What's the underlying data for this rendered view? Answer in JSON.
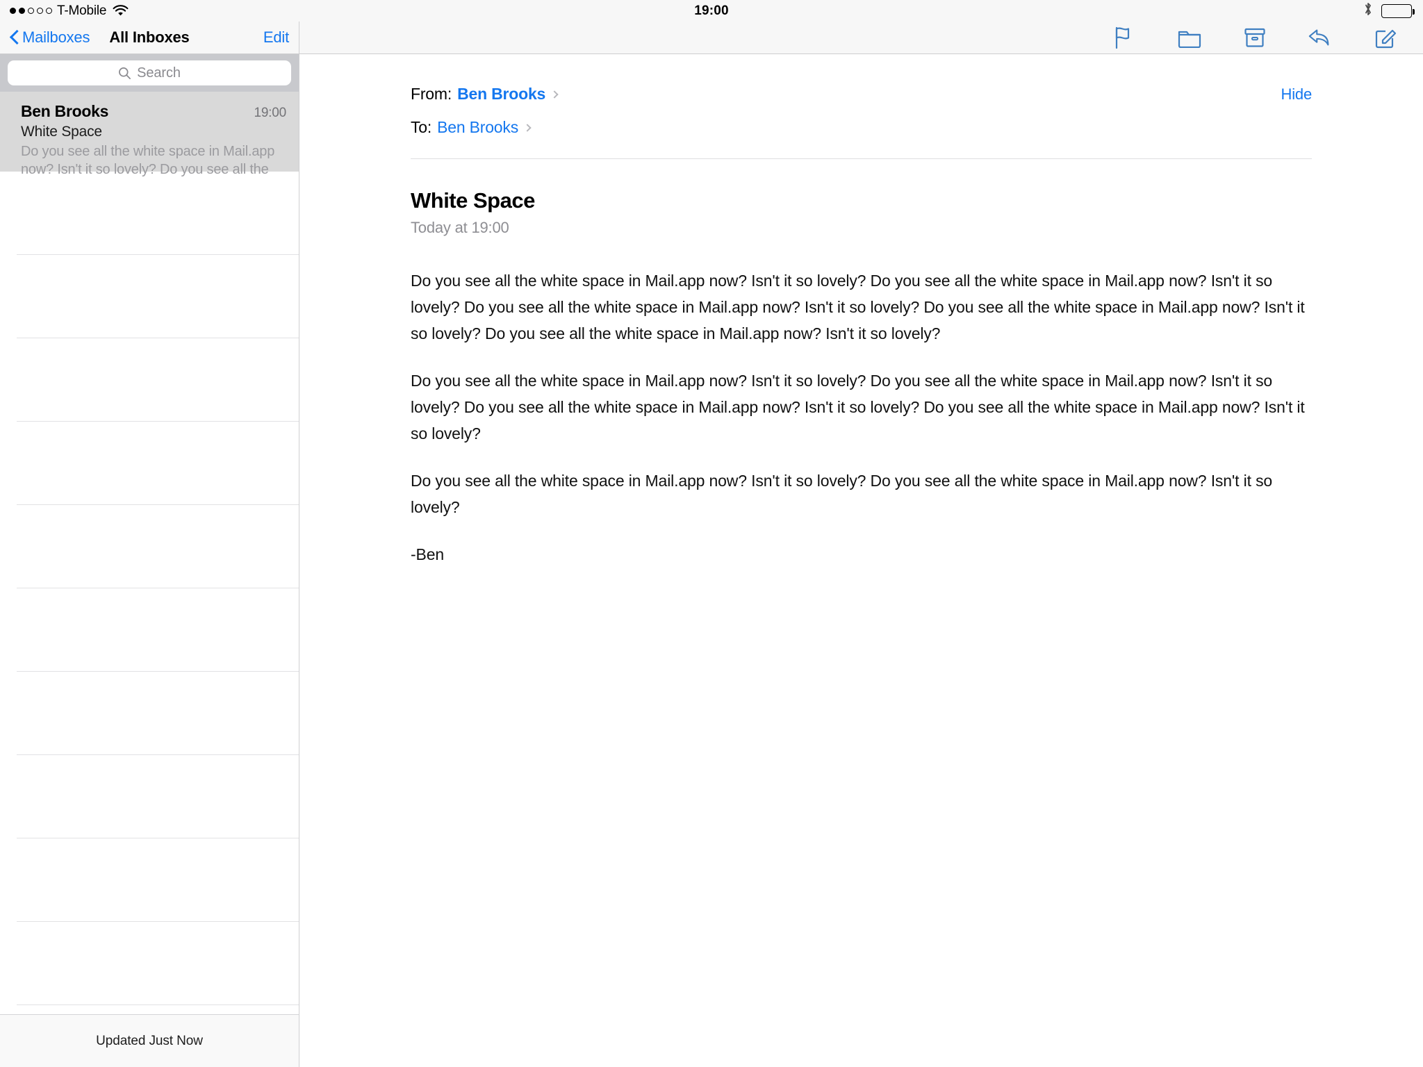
{
  "status_bar": {
    "signal_dots_filled": 2,
    "signal_dots_total": 5,
    "carrier": "T-Mobile",
    "wifi_icon": "wifi-icon",
    "time": "19:00",
    "bluetooth_icon": "bluetooth-icon",
    "battery_icon": "battery-full-icon"
  },
  "master": {
    "back_label": "Mailboxes",
    "title": "All Inboxes",
    "edit_label": "Edit",
    "search": {
      "placeholder": "Search",
      "icon": "search-icon"
    },
    "messages": [
      {
        "sender": "Ben Brooks",
        "time": "19:00",
        "subject": "White Space",
        "preview": "Do you see all the white space in Mail.app now? Isn't it so lovely? Do you see all the white spac…",
        "selected": true
      }
    ],
    "empty_row_count": 10,
    "footer_status": "Updated Just Now"
  },
  "detail": {
    "toolbar": [
      {
        "name": "flag-icon",
        "label": "Flag"
      },
      {
        "name": "folder-icon",
        "label": "Move to Folder"
      },
      {
        "name": "archive-icon",
        "label": "Archive"
      },
      {
        "name": "reply-icon",
        "label": "Reply"
      },
      {
        "name": "compose-icon",
        "label": "Compose"
      }
    ],
    "from_label": "From:",
    "from_name": "Ben Brooks",
    "to_label": "To:",
    "to_name": "Ben Brooks",
    "hide_label": "Hide",
    "subject": "White Space",
    "date": "Today at 19:00",
    "body_paragraphs": [
      "Do you see all the white space in Mail.app now? Isn't it so lovely? Do you see all the white space in Mail.app now? Isn't it so lovely? Do you see all the white space in Mail.app now? Isn't it so lovely? Do you see all the white space in Mail.app now? Isn't it so lovely? Do you see all the white space in Mail.app now? Isn't it so lovely?",
      "Do you see all the white space in Mail.app now? Isn't it so lovely? Do you see all the white space in Mail.app now? Isn't it so lovely? Do you see all the white space in Mail.app now? Isn't it so lovely? Do you see all the white space in Mail.app now? Isn't it so lovely?",
      "Do you see all the white space in Mail.app now? Isn't it so lovely? Do you see all the white space in Mail.app now? Isn't it so lovely?",
      "-Ben"
    ]
  },
  "colors": {
    "accent_blue": "#1477ef",
    "nav_background": "#f7f7f7",
    "search_background": "#c8c9cd",
    "selected_row": "#d9d9d9",
    "preview_gray": "#9b9b9f",
    "separator": "#e2e2e4"
  }
}
